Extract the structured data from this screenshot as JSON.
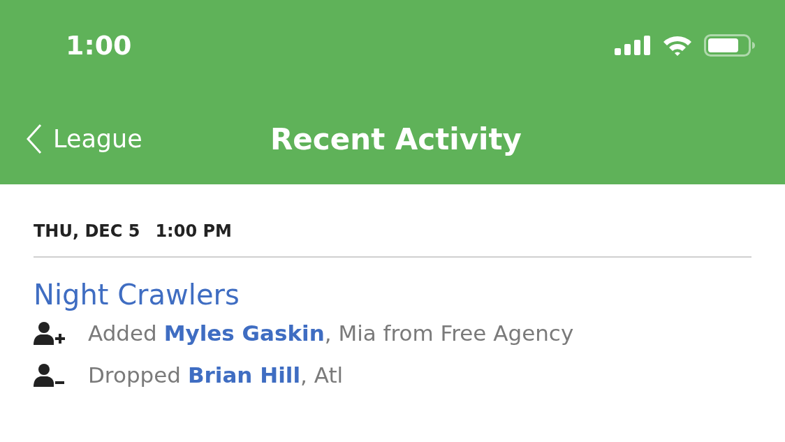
{
  "status_bar": {
    "time": "1:00"
  },
  "nav_bar": {
    "back_label": "League",
    "title": "Recent Activity"
  },
  "activity": [
    {
      "date": "THU, DEC 5",
      "time": "1:00 PM",
      "team": "Night Crawlers",
      "transactions": [
        {
          "kind": "add",
          "action": "Added",
          "player": "Myles Gaskin",
          "detail": ", Mia from Free Agency"
        },
        {
          "kind": "drop",
          "action": "Dropped",
          "player": "Brian Hill",
          "detail": ", Atl"
        }
      ]
    }
  ]
}
